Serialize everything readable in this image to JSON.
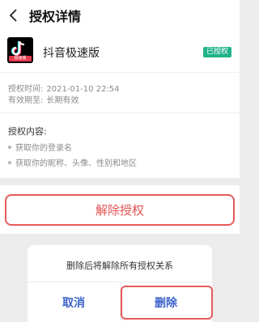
{
  "header": {
    "title": "授权详情",
    "back_icon": "back-chevron-icon"
  },
  "app": {
    "name": "抖音极速版",
    "icon": "douyin-lite-icon",
    "icon_tag": "极速版",
    "badge": "已授权",
    "badge_color": "#21b38a"
  },
  "info": {
    "time_label": "授权时间:",
    "time_value": "2021-01-10 22:54",
    "expiry_label": "有效期至:",
    "expiry_value": "长期有效"
  },
  "permissions": {
    "title": "授权内容:",
    "items": [
      "获取你的登录名",
      "获取你的昵称、头像、性别和地区"
    ]
  },
  "revoke": {
    "label": "解除授权",
    "color": "#e15353"
  },
  "dialog": {
    "message": "删除后将解除所有授权关系",
    "cancel_label": "取消",
    "delete_label": "删除",
    "button_color": "#3a63c8"
  }
}
